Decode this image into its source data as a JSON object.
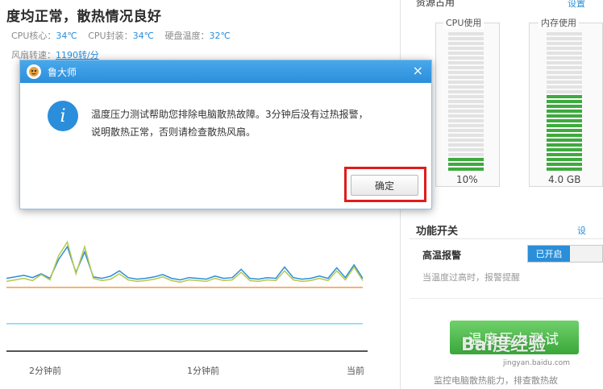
{
  "status": {
    "headline": "度均正常，散热情况良好",
    "cpu_core_label": "CPU核心：",
    "cpu_core_value": "34℃",
    "cpu_package_label": "CPU封装：",
    "cpu_package_value": "34℃",
    "disk_label": "硬盘温度：",
    "disk_value": "32℃",
    "fan_label": "风扇转速：",
    "fan_value": "1190转/分"
  },
  "chart_data": {
    "type": "line",
    "x_ticks": [
      "2分钟前",
      "1分钟前",
      "当前"
    ],
    "series": [
      {
        "color": "#2a8ed8",
        "values": [
          0.3,
          0.32,
          0.34,
          0.31,
          0.36,
          0.3,
          0.55,
          0.72,
          0.38,
          0.65,
          0.32,
          0.3,
          0.33,
          0.4,
          0.31,
          0.29,
          0.3,
          0.32,
          0.35,
          0.3,
          0.28,
          0.31,
          0.3,
          0.29,
          0.33,
          0.3,
          0.31,
          0.42,
          0.3,
          0.29,
          0.31,
          0.3,
          0.45,
          0.31,
          0.29,
          0.3,
          0.33,
          0.3,
          0.44,
          0.31,
          0.48,
          0.3
        ]
      },
      {
        "color": "#b6c84a",
        "values": [
          0.26,
          0.28,
          0.3,
          0.27,
          0.35,
          0.28,
          0.6,
          0.78,
          0.36,
          0.72,
          0.3,
          0.27,
          0.29,
          0.36,
          0.28,
          0.26,
          0.27,
          0.29,
          0.32,
          0.27,
          0.25,
          0.28,
          0.27,
          0.26,
          0.3,
          0.27,
          0.28,
          0.38,
          0.27,
          0.26,
          0.28,
          0.27,
          0.4,
          0.28,
          0.26,
          0.27,
          0.3,
          0.27,
          0.4,
          0.28,
          0.45,
          0.27
        ]
      },
      {
        "color": "#f29a4a",
        "values": [
          0.18,
          0.18,
          0.18,
          0.18,
          0.18,
          0.18,
          0.18,
          0.18,
          0.18,
          0.18,
          0.18,
          0.18,
          0.18,
          0.18,
          0.18,
          0.18,
          0.18,
          0.18,
          0.18,
          0.18,
          0.18,
          0.18,
          0.18,
          0.18,
          0.18,
          0.18,
          0.18,
          0.18,
          0.18,
          0.18,
          0.18,
          0.18,
          0.18,
          0.18,
          0.18,
          0.18,
          0.18,
          0.18,
          0.18,
          0.18,
          0.18,
          0.18
        ]
      },
      {
        "color": "#7fd4f2",
        "values": [
          -0.3,
          -0.3,
          -0.3,
          -0.3,
          -0.3,
          -0.3,
          -0.3,
          -0.3,
          -0.3,
          -0.3,
          -0.3,
          -0.3,
          -0.3,
          -0.3,
          -0.3,
          -0.3,
          -0.3,
          -0.3,
          -0.3,
          -0.3,
          -0.3,
          -0.3,
          -0.3,
          -0.3,
          -0.3,
          -0.3,
          -0.3,
          -0.3,
          -0.3,
          -0.3,
          -0.3,
          -0.3,
          -0.3,
          -0.3,
          -0.3,
          -0.3,
          -0.3,
          -0.3,
          -0.3,
          -0.3,
          -0.3,
          -0.3
        ]
      }
    ],
    "ylim": [
      -0.6,
      1.0
    ]
  },
  "resources": {
    "title": "资源占用",
    "link": "设置",
    "cpu": {
      "label": "CPU使用",
      "value_text": "10%",
      "usage": 0.1
    },
    "mem": {
      "label": "内存使用",
      "value_text": "4.0 GB",
      "usage": 0.55
    }
  },
  "functions": {
    "title": "功能开关",
    "link": "设",
    "alarm_label": "高温报警",
    "alarm_state": "已开启",
    "alarm_desc": "当温度过高时，报警提醒",
    "test_button": "温度压力测试",
    "test_desc": "监控电脑散热能力，排查散热故"
  },
  "watermark": {
    "brand": "Bai度经验",
    "sub": "jingyan.baidu.com"
  },
  "dialog": {
    "title": "鲁大师",
    "close": "×",
    "info_glyph": "i",
    "message_line1": "温度压力测试帮助您排除电脑散热故障。3分钟后没有过热报警，",
    "message_line2": "说明散热正常，否则请检查散热风扇。",
    "ok_label": "确定"
  },
  "colors": {
    "accent": "#2a8ed8",
    "green": "#3eaa3e",
    "highlight": "#e01c1c"
  }
}
